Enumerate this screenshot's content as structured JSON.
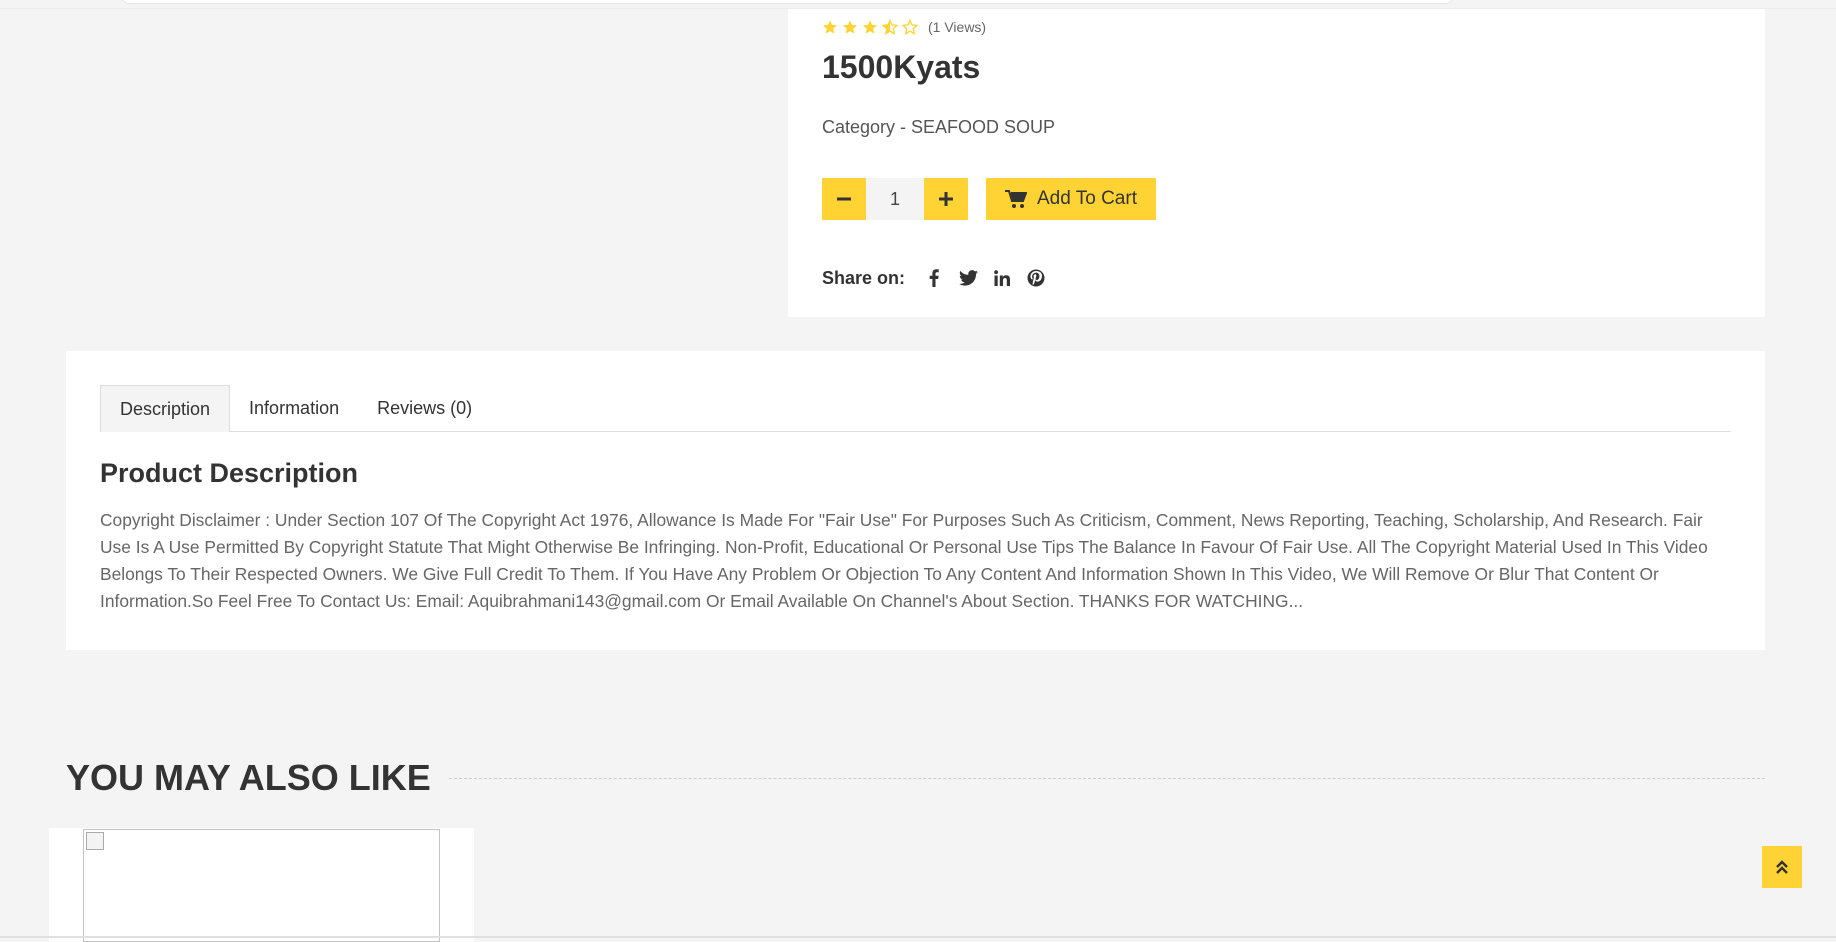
{
  "product": {
    "rating": 3.5,
    "views": "(1 Views)",
    "price": "1500Kyats",
    "category": "Category - SEAFOOD SOUP",
    "quantity": "1",
    "add_to_cart": "Add To Cart",
    "share_label": "Share on:",
    "social_icons": [
      "facebook-icon",
      "twitter-icon",
      "linkedin-icon",
      "pinterest-icon"
    ]
  },
  "tabs": [
    {
      "label": "Description",
      "active": true
    },
    {
      "label": "Information",
      "active": false
    },
    {
      "label": "Reviews (0)",
      "active": false
    }
  ],
  "description": {
    "title": "Product Description",
    "text": "Copyright Disclaimer : Under Section 107 Of The Copyright Act 1976, Allowance Is Made For \"Fair Use\" For Purposes Such As Criticism, Comment, News Reporting, Teaching, Scholarship, And Research. Fair Use Is A Use Permitted By Copyright Statute That Might Otherwise Be Infringing. Non-Profit, Educational Or Personal Use Tips The Balance In Favour Of Fair Use. All The Copyright Material Used In This Video Belongs To Their Respected Owners. We Give Full Credit To Them. If You Have Any Problem Or Objection To Any Content And Information Shown In This Video, We Will Remove Or Blur That Content Or Information.So Feel Free To Contact Us: Email: Aquibrahmani143@gmail.com Or Email Available On Channel's About Section. THANKS FOR WATCHING..."
  },
  "related": {
    "title": "YOU MAY ALSO LIKE"
  },
  "colors": {
    "accent": "#FFD333",
    "background": "#F4F4F4",
    "text": "#333333"
  }
}
